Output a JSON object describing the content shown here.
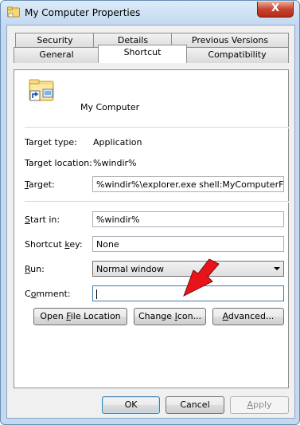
{
  "window": {
    "title": "My Computer Properties",
    "close_label": "X"
  },
  "tabs": {
    "row1": [
      "Security",
      "Details",
      "Previous Versions"
    ],
    "row2": [
      "General",
      "Shortcut",
      "Compatibility"
    ],
    "active": "Shortcut"
  },
  "shortcut": {
    "name": "My Computer",
    "target_type_label": "Target type:",
    "target_type_value": "Application",
    "target_location_label": "Target location:",
    "target_location_value": "%windir%",
    "target_label_u": "T",
    "target_label_rest": "arget:",
    "target_value": "%windir%\\explorer.exe shell:MyComputerFolder",
    "start_in_label_u": "S",
    "start_in_label_rest": "tart in:",
    "start_in_value": "%windir%",
    "shortcut_key_label_pre": "Shortcut ",
    "shortcut_key_label_u": "k",
    "shortcut_key_label_rest": "ey:",
    "shortcut_key_value": "None",
    "run_label_u": "R",
    "run_label_rest": "un:",
    "run_value": "Normal window",
    "comment_label_pre": "C",
    "comment_label_u": "o",
    "comment_label_rest": "mment:",
    "comment_value": ""
  },
  "buttons": {
    "open_file_location_pre": "Open ",
    "open_file_location_u": "F",
    "open_file_location_rest": "ile Location",
    "change_icon_pre": "Change ",
    "change_icon_u": "I",
    "change_icon_rest": "con...",
    "advanced_u": "A",
    "advanced_rest": "dvanced...",
    "ok": "OK",
    "cancel": "Cancel",
    "apply_u": "A",
    "apply_rest": "pply"
  },
  "colors": {
    "annotation_arrow": "#e8141b"
  }
}
